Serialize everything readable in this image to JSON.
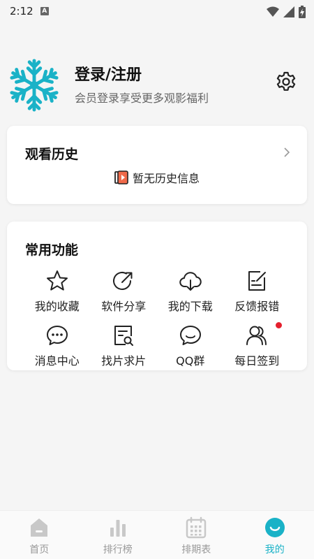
{
  "status_bar": {
    "time": "2:12",
    "notification_letter": "A"
  },
  "profile": {
    "title": "登录/注册",
    "subtitle": "会员登录享受更多观影福利"
  },
  "history": {
    "title": "观看历史",
    "empty_text": "暂无历史信息"
  },
  "functions": {
    "title": "常用功能",
    "items": [
      {
        "label": "我的收藏",
        "icon": "star-icon"
      },
      {
        "label": "软件分享",
        "icon": "share-icon"
      },
      {
        "label": "我的下载",
        "icon": "cloud-download-icon"
      },
      {
        "label": "反馈报错",
        "icon": "feedback-icon"
      },
      {
        "label": "消息中心",
        "icon": "message-icon"
      },
      {
        "label": "找片求片",
        "icon": "search-document-icon"
      },
      {
        "label": "QQ群",
        "icon": "chat-group-icon"
      },
      {
        "label": "每日签到",
        "icon": "users-icon",
        "badge": true
      }
    ]
  },
  "bottom_nav": {
    "items": [
      {
        "label": "首页",
        "icon": "home-icon"
      },
      {
        "label": "排行榜",
        "icon": "ranking-icon"
      },
      {
        "label": "排期表",
        "icon": "calendar-icon"
      },
      {
        "label": "我的",
        "icon": "profile-smile-icon",
        "active": true
      }
    ]
  },
  "colors": {
    "accent": "#1ab2c7",
    "badge": "#e5202e",
    "avatar": "#1ab2c7"
  }
}
